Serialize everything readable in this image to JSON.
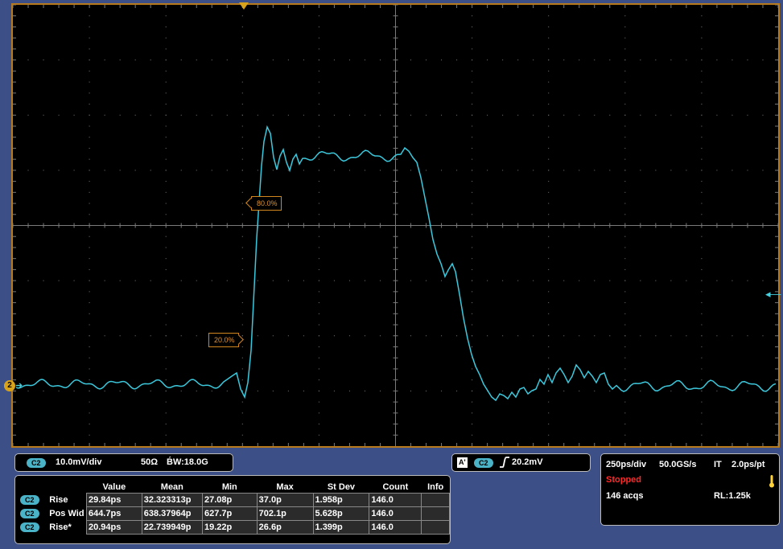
{
  "display": {
    "ch_marker": "2",
    "marker_80": "80.0%",
    "marker_20": "20.0%"
  },
  "channel": {
    "badge": "C2",
    "scale": "10.0mV/div",
    "impedance": "50Ω",
    "bandwidth": "B́W:18.0G"
  },
  "trigger": {
    "mode_badge": "A'",
    "channel_badge": "C2",
    "slope_icon": "rising-edge-icon",
    "level": "20.2mV"
  },
  "timebase": {
    "scale": "250ps/div",
    "sample_rate": "50.0GS/s",
    "mode": "IT",
    "resolution": "2.0ps/pt",
    "status": "Stopped",
    "acquisitions": "146 acqs",
    "record_length": "RL:1.25k",
    "status_color": "#ff2a2a"
  },
  "measurements": {
    "headers": [
      "Value",
      "Mean",
      "Min",
      "Max",
      "St Dev",
      "Count",
      "Info"
    ],
    "rows": [
      {
        "badge": "C2",
        "label": "Rise",
        "value": "29.84ps",
        "mean": "32.323313p",
        "min": "27.08p",
        "max": "37.0p",
        "stdev": "1.958p",
        "count": "146.0",
        "info": ""
      },
      {
        "badge": "C2",
        "label": "Pos Wid",
        "value": "644.7ps",
        "mean": "638.37964p",
        "min": "627.7p",
        "max": "702.1p",
        "stdev": "5.628p",
        "count": "146.0",
        "info": ""
      },
      {
        "badge": "C2",
        "label": "Rise*",
        "value": "20.94ps",
        "mean": "22.739949p",
        "min": "19.22p",
        "max": "26.6p",
        "stdev": "1.399p",
        "count": "146.0",
        "info": ""
      }
    ]
  },
  "colors": {
    "trace": "#3cc8dc",
    "graticule": "#7a7a7a",
    "frame": "#b77a1d",
    "marker": "#d8a21a"
  }
}
